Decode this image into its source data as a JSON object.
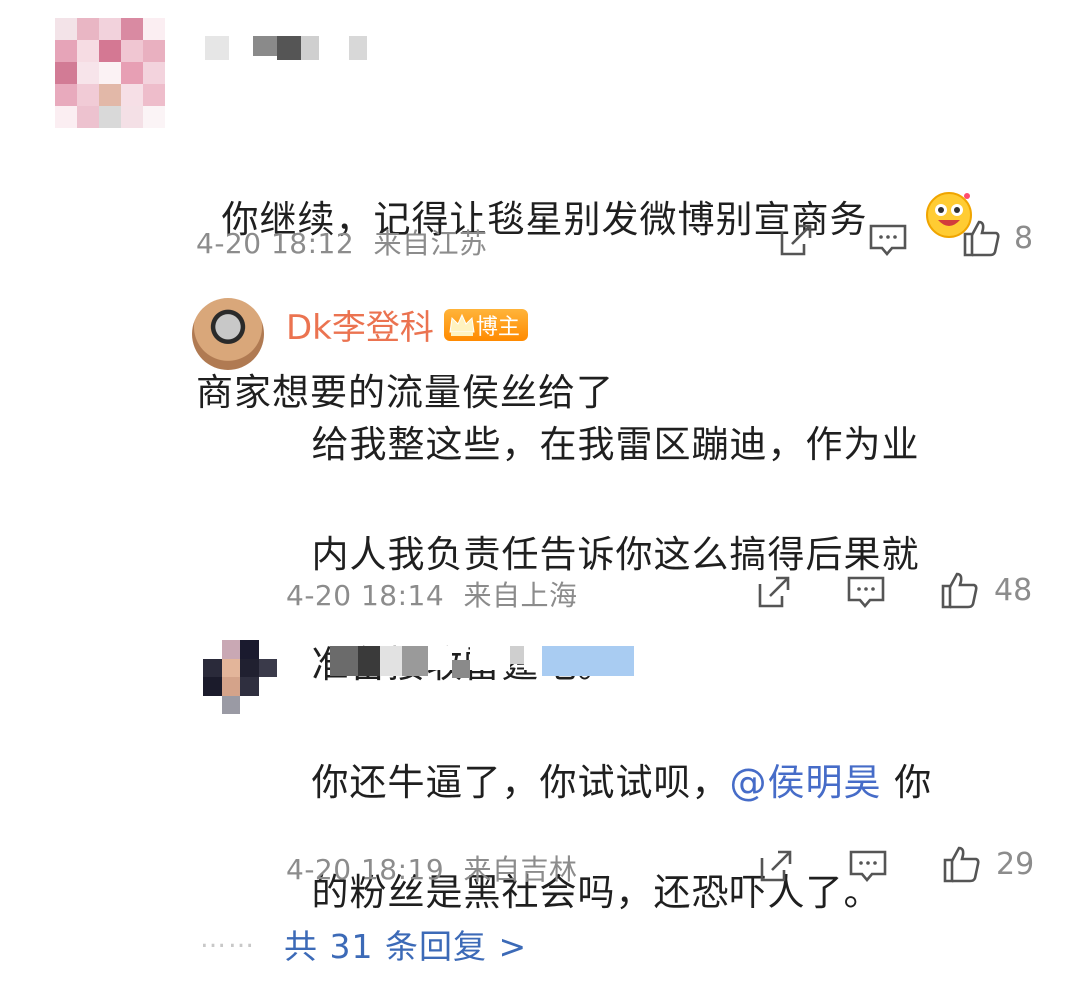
{
  "main_comment": {
    "text_line1": "你继续，记得让毯星别发微博别宣商务",
    "text_line2": "商家想要的流量侯丝给了",
    "emoji": "emoji-grinning-face",
    "timestamp": "4-20 18:12",
    "location": "来自江苏",
    "likes": "8"
  },
  "reply1": {
    "username": "Dk李登科",
    "badge_label": "博主",
    "text_line1": "给我整这些，在我雷区蹦迪，作为业",
    "text_line2": "内人我负责任告诉你这么搞得后果就",
    "text_line3": "准备接收雷霆吧。",
    "timestamp": "4-20 18:14",
    "location": "来自上海",
    "likes": "48"
  },
  "reply2": {
    "text_line1_prefix": "你还牛逼了，你试试呗，",
    "mention": "@侯明昊",
    "text_line1_suffix": " 你",
    "text_line2": "的粉丝是黑社会吗，还恐吓人了。",
    "timestamp": "4-20 18:19",
    "location": "来自吉林",
    "likes": "29"
  },
  "footer": {
    "dots": "……",
    "replies_link": "共 31 条回复 >"
  },
  "colors": {
    "username": "#eb7350",
    "mention": "#466cc8",
    "link": "#3c6ab7",
    "meta": "#8c8c8c"
  }
}
